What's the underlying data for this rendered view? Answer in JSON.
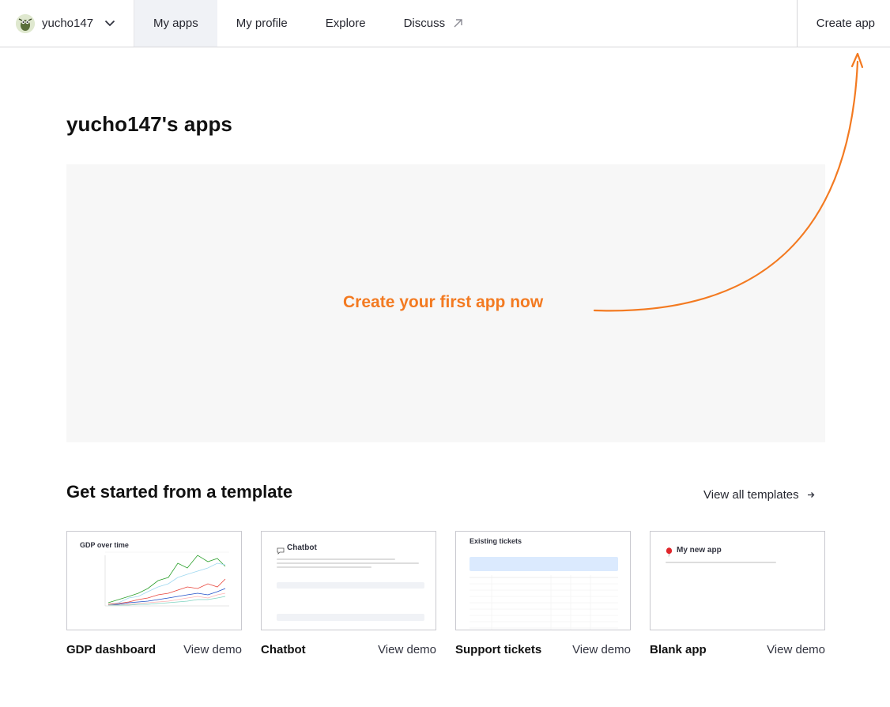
{
  "nav": {
    "username": "yucho147",
    "items": [
      {
        "label": "My apps",
        "active": true
      },
      {
        "label": "My profile",
        "active": false
      },
      {
        "label": "Explore",
        "active": false
      },
      {
        "label": "Discuss",
        "active": false,
        "external": true
      }
    ],
    "create_app_label": "Create app"
  },
  "main": {
    "title": "yucho147's apps",
    "cta_label": "Create your first app now"
  },
  "templates": {
    "title": "Get started from a template",
    "view_all_label": "View all templates",
    "cards": [
      {
        "name": "GDP dashboard",
        "demo_label": "View demo",
        "thumb_title": "GDP over time"
      },
      {
        "name": "Chatbot",
        "demo_label": "View demo",
        "thumb_title": "Chatbot"
      },
      {
        "name": "Support tickets",
        "demo_label": "View demo",
        "thumb_title": "Existing tickets"
      },
      {
        "name": "Blank app",
        "demo_label": "View demo",
        "thumb_title": "My new app"
      }
    ]
  },
  "colors": {
    "accent": "#f37a21",
    "nav_active_bg": "#f0f2f6",
    "empty_area_bg": "#f7f7f7"
  },
  "icons": {
    "user_menu": "chevron-down-icon",
    "external_link": "arrow-up-right-icon",
    "view_all": "arrow-right-icon",
    "chatbot": "speech-bubble-icon",
    "blank_app": "balloon-icon"
  }
}
